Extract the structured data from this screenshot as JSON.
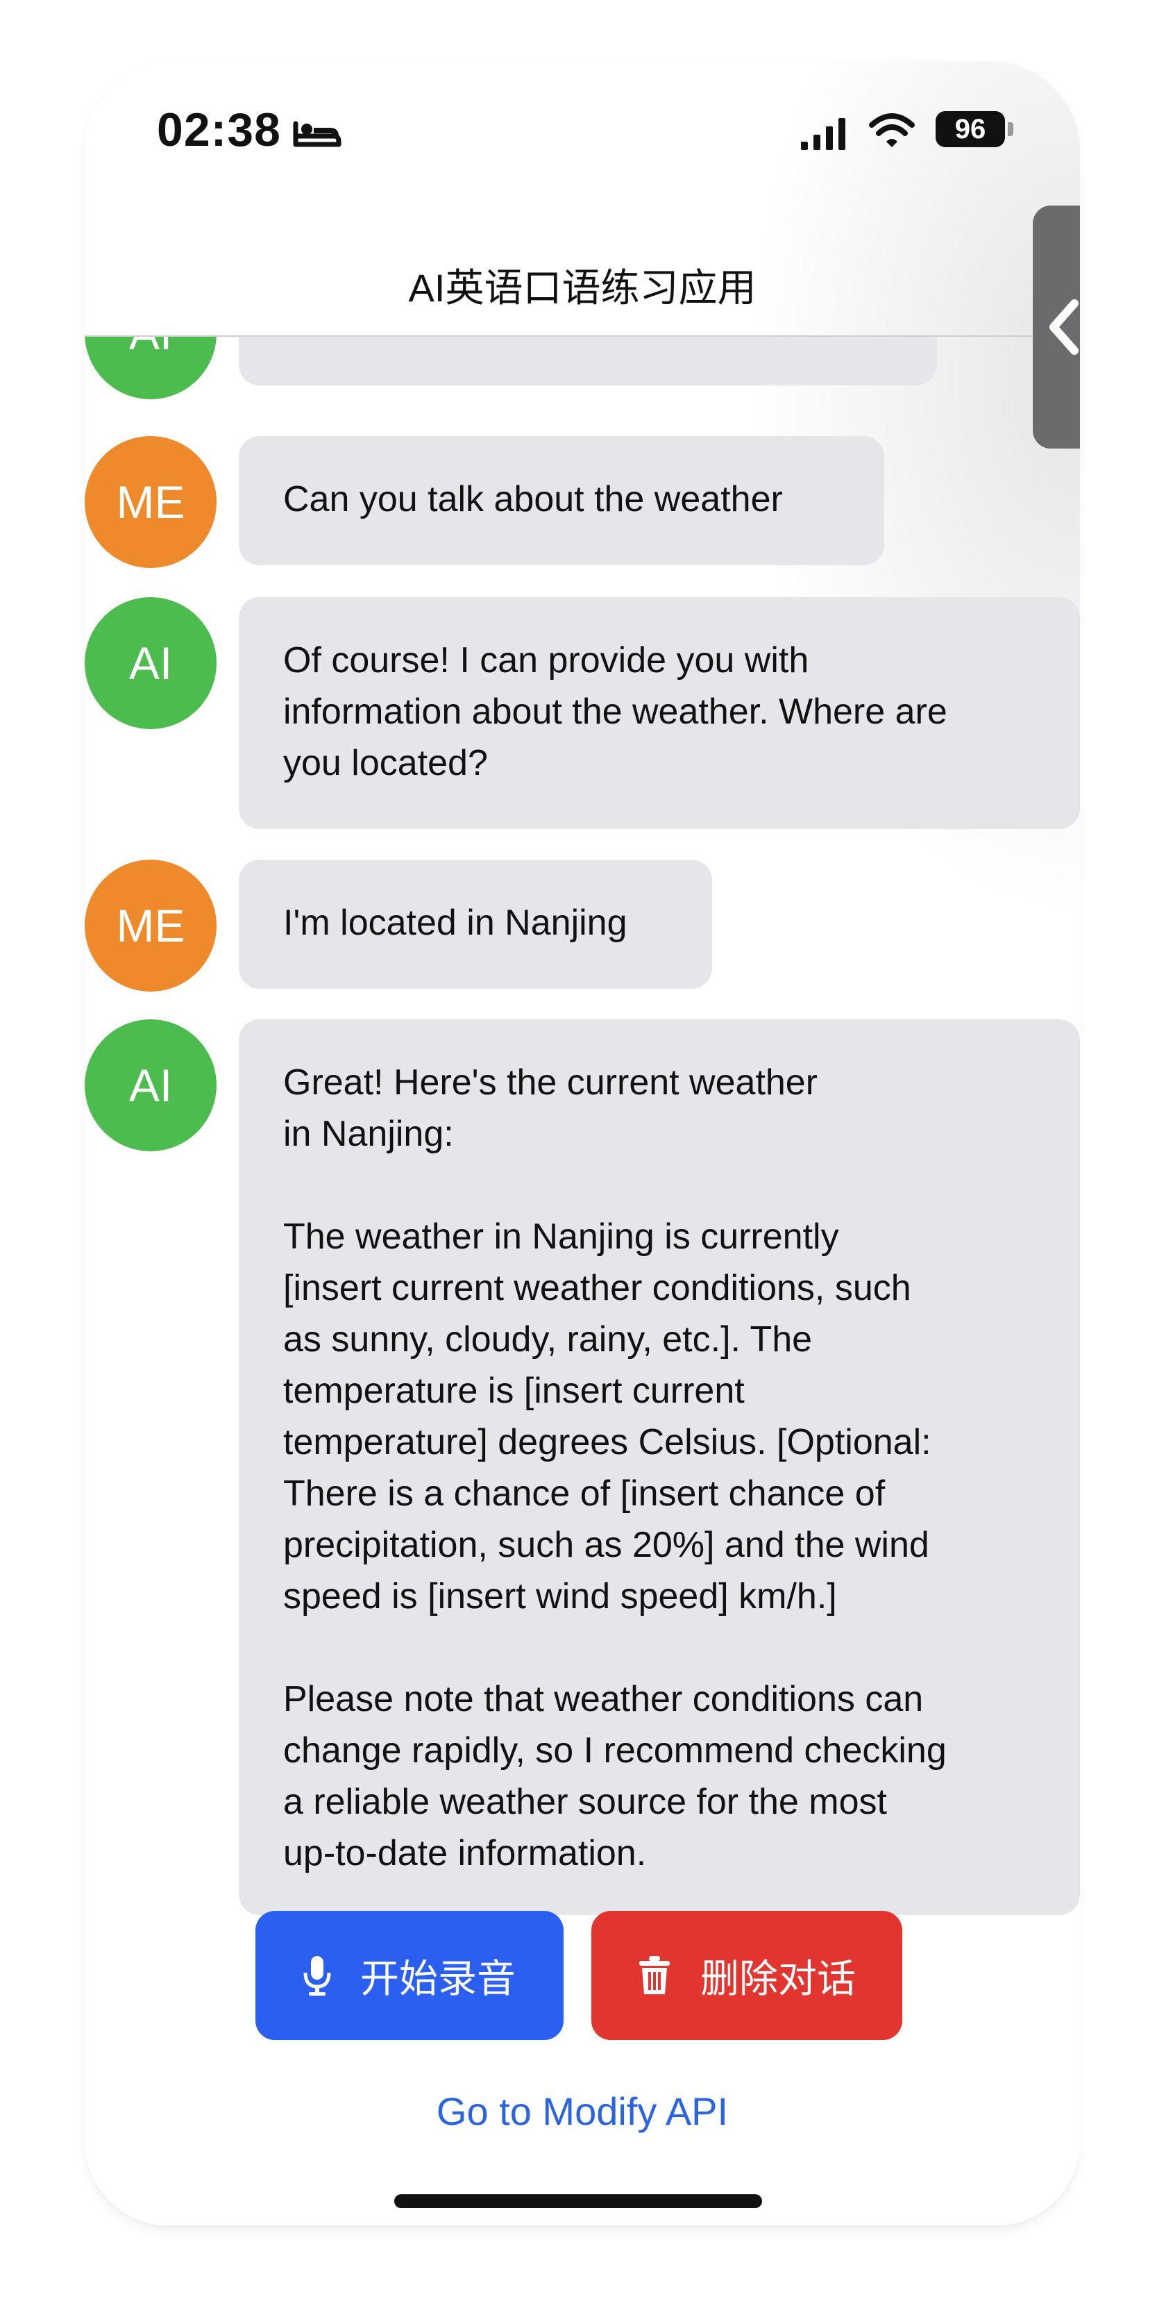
{
  "status_bar": {
    "time": "02:38",
    "battery": "96",
    "icons": [
      "sleep-icon",
      "signal-icon",
      "wifi-icon",
      "battery-icon"
    ]
  },
  "nav": {
    "title": "AI英语口语练习应用"
  },
  "messages": [
    {
      "sender": "AI",
      "avatar_label": "AI",
      "text": ""
    },
    {
      "sender": "ME",
      "avatar_label": "ME",
      "text": "Can you talk about the weather"
    },
    {
      "sender": "AI",
      "avatar_label": "AI",
      "text": "Of course! I can provide you with\ninformation about the weather. Where are\nyou located?"
    },
    {
      "sender": "ME",
      "avatar_label": "ME",
      "text": "I'm located in Nanjing"
    },
    {
      "sender": "AI",
      "avatar_label": "AI",
      "text": "Great! Here's the current weather\nin Nanjing:\n\nThe weather in Nanjing is currently\n[insert current weather conditions, such\nas sunny, cloudy, rainy, etc.]. The\ntemperature is [insert current\ntemperature] degrees Celsius. [Optional:\nThere is a chance of [insert chance of\nprecipitation, such as 20%] and the wind\nspeed is [insert wind speed] km/h.]\n\nPlease note that weather conditions can\nchange rapidly, so I recommend checking\na reliable weather source for the most\nup-to-date information."
    }
  ],
  "actions": {
    "record_label": "开始录音",
    "delete_label": "删除对话",
    "record_icon": "microphone-icon",
    "delete_icon": "trash-icon"
  },
  "footer": {
    "modify_api_link": "Go to Modify API"
  },
  "colors": {
    "ai_avatar": "#4cbc4f",
    "me_avatar": "#ee8a2b",
    "bubble": "#e5e5ea",
    "record_button": "#2a5ff0",
    "delete_button": "#e2352f",
    "link": "#2a64e0"
  }
}
